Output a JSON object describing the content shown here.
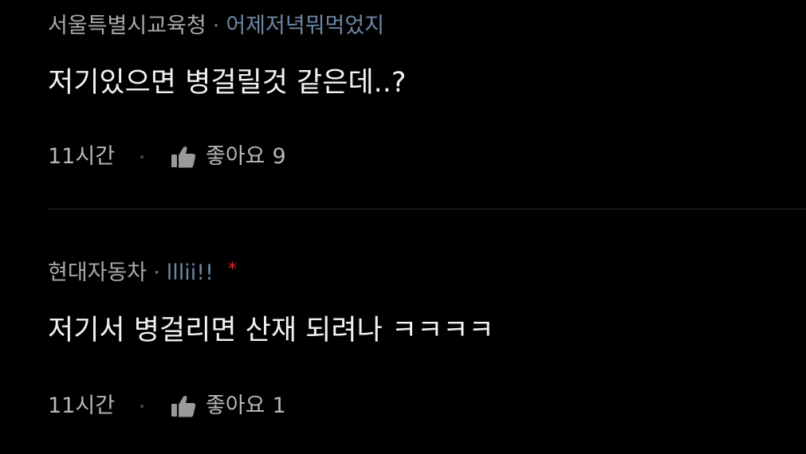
{
  "comments": [
    {
      "company": "서울특별시교육청",
      "separator": "·",
      "nickname": "어제저녁뭐먹었지",
      "text": "저기있으면 병걸릴것 같은데..?",
      "time": "11시간",
      "like_label": "좋아요",
      "like_count": "9"
    },
    {
      "company": "현대자동차",
      "separator": "·",
      "nickname": "lllii!!",
      "marker": "*",
      "text": "저기서 병걸리면 산재 되려나 ㅋㅋㅋㅋ",
      "time": "11시간",
      "like_label": "좋아요",
      "like_count": "1"
    }
  ],
  "colors": {
    "background": "#000000",
    "company": "#a9a9a9",
    "nickname": "#6c86a3",
    "marker": "#e8282f",
    "body_text": "#f2f2f2",
    "action_text": "#b8b8b8"
  },
  "icons": {
    "like": "thumbs-up-icon"
  }
}
